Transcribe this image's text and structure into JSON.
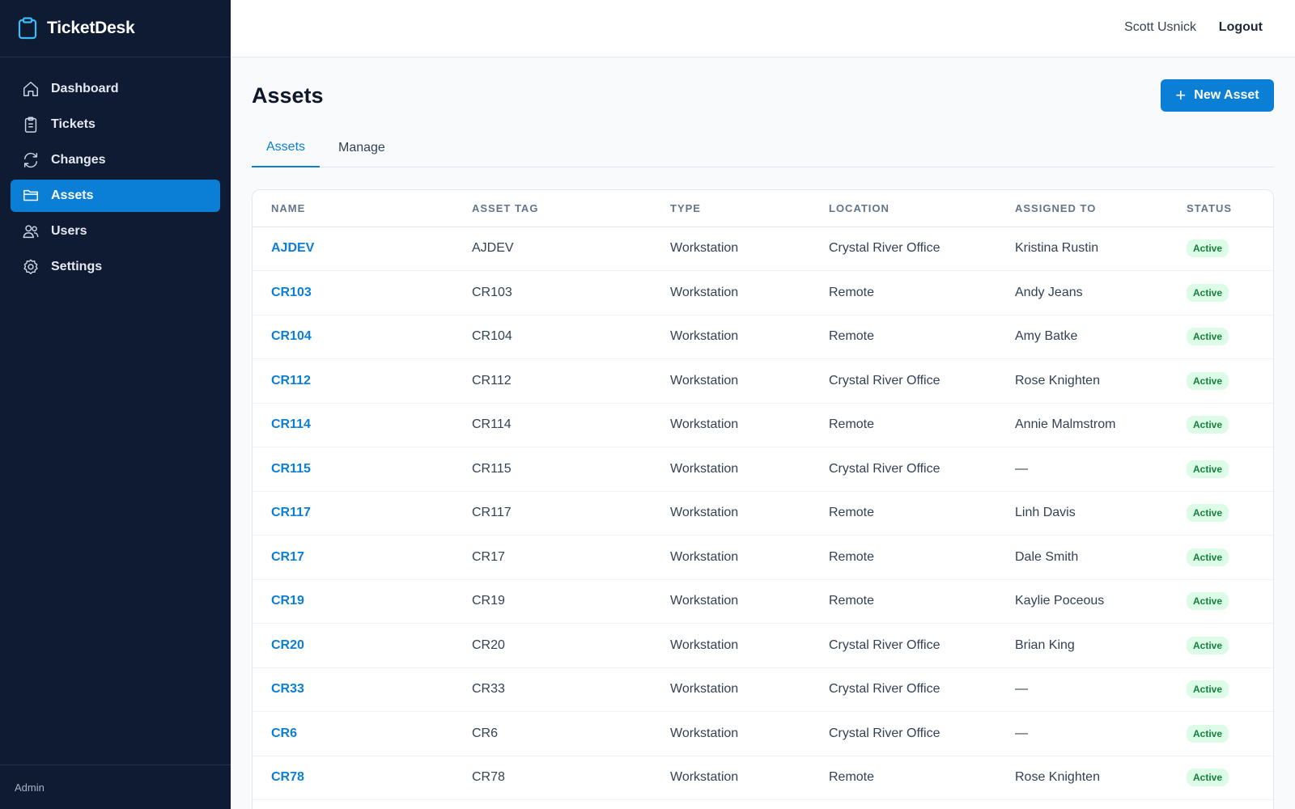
{
  "app": {
    "name": "TicketDesk"
  },
  "sidebar": {
    "items": [
      {
        "label": "Dashboard",
        "icon": "home-icon"
      },
      {
        "label": "Tickets",
        "icon": "clipboard-icon"
      },
      {
        "label": "Changes",
        "icon": "refresh-icon"
      },
      {
        "label": "Assets",
        "icon": "folder-icon",
        "active": true
      },
      {
        "label": "Users",
        "icon": "users-icon"
      },
      {
        "label": "Settings",
        "icon": "gear-icon"
      }
    ],
    "footer": "Admin"
  },
  "header": {
    "user_name": "Scott Usnick",
    "logout_label": "Logout"
  },
  "page": {
    "title": "Assets",
    "new_button_label": "New Asset"
  },
  "tabs": [
    {
      "label": "Assets",
      "active": true
    },
    {
      "label": "Manage"
    }
  ],
  "table": {
    "columns": [
      "NAME",
      "ASSET TAG",
      "TYPE",
      "LOCATION",
      "ASSIGNED TO",
      "STATUS"
    ],
    "rows": [
      {
        "name": "AJDEV",
        "tag": "AJDEV",
        "type": "Workstation",
        "location": "Crystal River Office",
        "assigned": "Kristina Rustin",
        "status": "Active"
      },
      {
        "name": "CR103",
        "tag": "CR103",
        "type": "Workstation",
        "location": "Remote",
        "assigned": "Andy Jeans",
        "status": "Active"
      },
      {
        "name": "CR104",
        "tag": "CR104",
        "type": "Workstation",
        "location": "Remote",
        "assigned": "Amy Batke",
        "status": "Active"
      },
      {
        "name": "CR112",
        "tag": "CR112",
        "type": "Workstation",
        "location": "Crystal River Office",
        "assigned": "Rose Knighten",
        "status": "Active"
      },
      {
        "name": "CR114",
        "tag": "CR114",
        "type": "Workstation",
        "location": "Remote",
        "assigned": "Annie Malmstrom",
        "status": "Active"
      },
      {
        "name": "CR115",
        "tag": "CR115",
        "type": "Workstation",
        "location": "Crystal River Office",
        "assigned": "—",
        "status": "Active"
      },
      {
        "name": "CR117",
        "tag": "CR117",
        "type": "Workstation",
        "location": "Remote",
        "assigned": "Linh Davis",
        "status": "Active"
      },
      {
        "name": "CR17",
        "tag": "CR17",
        "type": "Workstation",
        "location": "Remote",
        "assigned": "Dale Smith",
        "status": "Active"
      },
      {
        "name": "CR19",
        "tag": "CR19",
        "type": "Workstation",
        "location": "Remote",
        "assigned": "Kaylie Poceous",
        "status": "Active"
      },
      {
        "name": "CR20",
        "tag": "CR20",
        "type": "Workstation",
        "location": "Crystal River Office",
        "assigned": "Brian King",
        "status": "Active"
      },
      {
        "name": "CR33",
        "tag": "CR33",
        "type": "Workstation",
        "location": "Crystal River Office",
        "assigned": "—",
        "status": "Active"
      },
      {
        "name": "CR6",
        "tag": "CR6",
        "type": "Workstation",
        "location": "Crystal River Office",
        "assigned": "—",
        "status": "Active"
      },
      {
        "name": "CR78",
        "tag": "CR78",
        "type": "Workstation",
        "location": "Remote",
        "assigned": "Rose Knighten",
        "status": "Active"
      }
    ]
  },
  "colors": {
    "sidebar_bg": "#0f1a33",
    "accent": "#0b7fd6",
    "status_active_bg": "#dcfce7",
    "status_active_text": "#15803d"
  }
}
